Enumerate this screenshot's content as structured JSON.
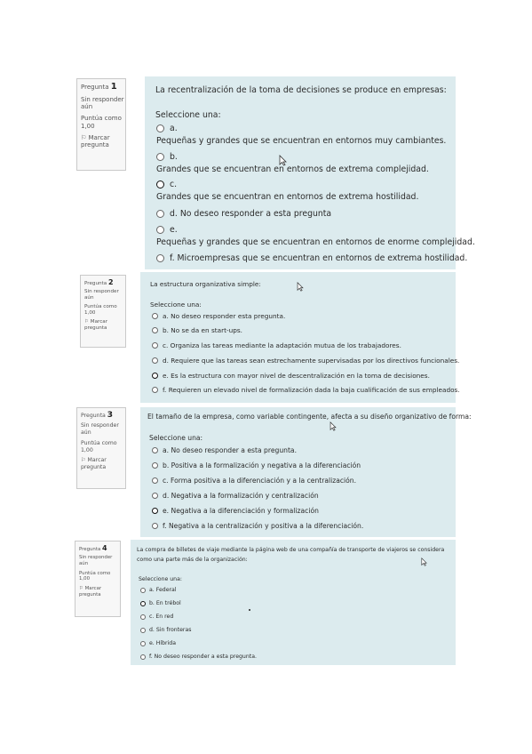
{
  "questions": [
    {
      "label": "Pregunta",
      "number": "1",
      "status": "Sin responder aún",
      "status_l1": "Sin responder",
      "status_l2": "aún",
      "score_l1": "Puntúa como",
      "score_l2": "1,00",
      "flag_l1": "Marcar",
      "flag_l2": "pregunta",
      "text": "La recentralización de la toma de decisiones se produce en empresas:",
      "prompt": "Seleccione una:",
      "selected": "c",
      "options": [
        {
          "letter": "a.",
          "text": "Pequeñas y grandes que se encuentran en entornos muy cambiantes."
        },
        {
          "letter": "b.",
          "text": "Grandes que se encuentran en entornos de extrema complejidad."
        },
        {
          "letter": "c.",
          "text": "Grandes que se encuentran en entornos de extrema hostilidad."
        },
        {
          "letter": "d.",
          "text": "No deseo responder a esta pregunta"
        },
        {
          "letter": "e.",
          "text": "Pequeñas y grandes que se encuentran en entornos de enorme complejidad."
        },
        {
          "letter": "f.",
          "text": "Microempresas que se encuentran en entornos de extrema hostilidad."
        }
      ]
    },
    {
      "label": "Pregunta",
      "number": "2",
      "status_l1": "Sin responder",
      "status_l2": "aún",
      "score_l1": "Puntúa como",
      "score_l2": "1,00",
      "flag_l1": "Marcar",
      "flag_l2": "pregunta",
      "text": "La estructura organizativa simple:",
      "prompt": "Seleccione una:",
      "selected": "e",
      "options": [
        {
          "letter": "a.",
          "text": "No deseo responder esta pregunta."
        },
        {
          "letter": "b.",
          "text": "No se da en start-ups."
        },
        {
          "letter": "c.",
          "text": "Organiza las tareas mediante la adaptación mutua de los trabajadores."
        },
        {
          "letter": "d.",
          "text": "Requiere que las tareas sean estrechamente supervisadas por los directivos funcionales."
        },
        {
          "letter": "e.",
          "text": "Es la estructura con mayor nivel de descentralización en la toma de decisiones."
        },
        {
          "letter": "f.",
          "text": "Requieren un elevado nivel de formalización dada la baja cualificación de sus empleados."
        }
      ]
    },
    {
      "label": "Pregunta",
      "number": "3",
      "status_l1": "Sin responder",
      "status_l2": "aún",
      "score_l1": "Puntúa como",
      "score_l2": "1,00",
      "flag_l1": "Marcar",
      "flag_l2": "pregunta",
      "text": "El tamaño de la empresa, como variable contingente, afecta a su diseño organizativo de forma:",
      "prompt": "Seleccione una:",
      "selected": "e",
      "options": [
        {
          "letter": "a.",
          "text": "No deseo responder a esta pregunta."
        },
        {
          "letter": "b.",
          "text": "Positiva a la formalización y negativa a la diferenciación"
        },
        {
          "letter": "c.",
          "text": "Forma positiva a la diferenciación y a la centralización."
        },
        {
          "letter": "d.",
          "text": "Negativa a la formalización y centralización"
        },
        {
          "letter": "e.",
          "text": "Negativa a la diferenciación y formalización"
        },
        {
          "letter": "f.",
          "text": "Negativa a la centralización y positiva a la diferenciación."
        }
      ]
    },
    {
      "label": "Pregunta",
      "number": "4",
      "status_l1": "Sin responder",
      "status_l2": "aún",
      "score_l1": "Puntúa como",
      "score_l2": "1,00",
      "flag_l1": "Marcar",
      "flag_l2": "pregunta",
      "text_l1": "La compra de billetes de viaje mediante la página web de una compañía de transporte de viajeros se considera",
      "text_l2": "como una parte más de la organización:",
      "prompt": "Seleccione una:",
      "selected": "b",
      "options": [
        {
          "letter": "a.",
          "text": "Federal"
        },
        {
          "letter": "b.",
          "text": "En trébol"
        },
        {
          "letter": "c.",
          "text": "En red"
        },
        {
          "letter": "d.",
          "text": "Sin fronteras"
        },
        {
          "letter": "e.",
          "text": "Híbrida"
        },
        {
          "letter": "f.",
          "text": "No deseo responder a esta pregunta."
        }
      ]
    }
  ]
}
